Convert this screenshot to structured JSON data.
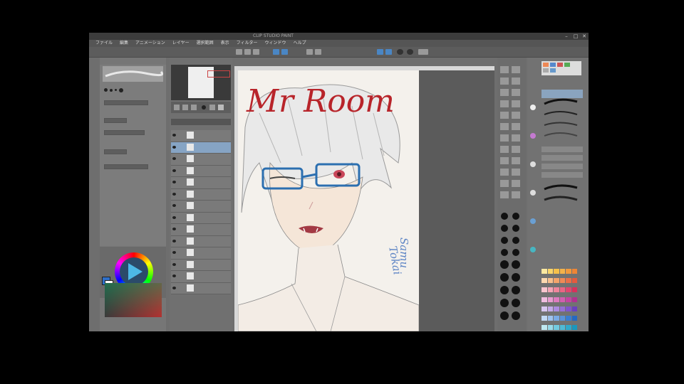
{
  "window": {
    "title": "CLIP STUDIO PAINT",
    "controls": [
      "–",
      "□",
      "✕"
    ]
  },
  "menu": {
    "items": [
      "ファイル",
      "編集",
      "アニメーション",
      "レイヤー",
      "選択範囲",
      "表示",
      "フィルター",
      "ウィンドウ",
      "ヘルプ"
    ]
  },
  "artwork": {
    "heading": "Mr Room",
    "signature_line1": "Samu",
    "signature_line2": "Tokai",
    "accent_red": "#b8242a",
    "glasses_blue": "#2c6fb0",
    "sign_blue": "#5e85c5"
  },
  "colors": {
    "main_color": "#2e6fc8",
    "sub_color": "#ffffff",
    "background": "#000000",
    "window_bg": "#6e6e6e"
  },
  "icons": [
    "pen-icon",
    "eraser-icon",
    "fill-icon",
    "eye-icon",
    "close-icon",
    "brush-icon"
  ]
}
